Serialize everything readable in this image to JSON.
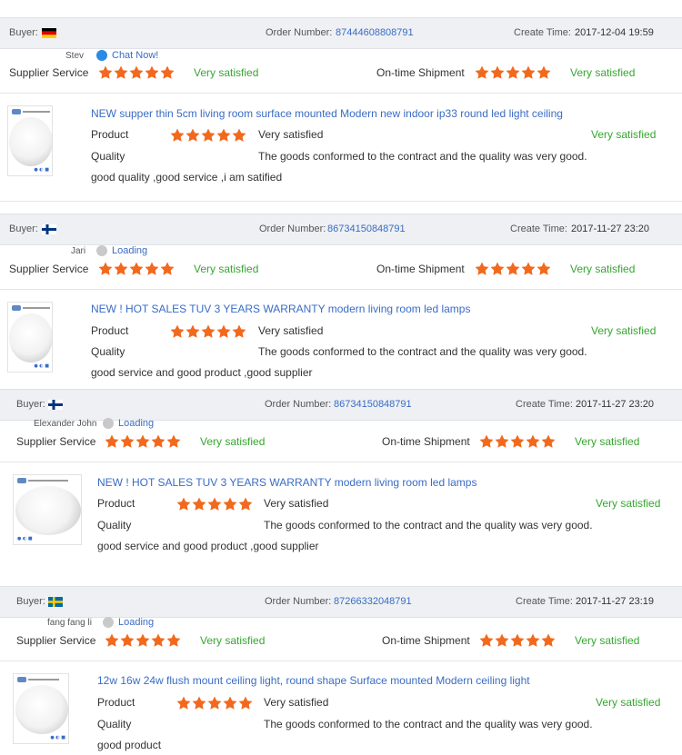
{
  "colors": {
    "link": "#3a6cc4",
    "positive": "#36a630",
    "star": "#f2691d",
    "header_bg": "#eef0f3"
  },
  "labels": {
    "buyer": "Buyer:",
    "order_number": "Order Number:",
    "create_time": "Create Time:",
    "supplier_service": "Supplier Service",
    "on_time_shipment": "On-time Shipment",
    "product": "Product",
    "quality": "Quality",
    "very_satisfied": "Very satisfied",
    "quality_text": "The goods conformed to the contract and the quality was very good."
  },
  "reviews": [
    {
      "buyer_country_flag": "germany",
      "order_number": "87444608808791",
      "create_time": "2017-12-04 19:59",
      "buyer_name": "Stev",
      "contact_link": "Chat Now!",
      "contact_icon": "chat-icon",
      "supplier_service_rating": 5,
      "on_time_shipment_rating": 5,
      "product_title": "NEW supper thin 5cm living room surface mounted Modern new indoor ip33 round led light ceiling",
      "product_rating": 5,
      "comment": "good quality ,good service ,i am satified"
    },
    {
      "buyer_country_flag": "finland",
      "order_number": "86734150848791",
      "create_time": "2017-11-27 23:20",
      "buyer_name": "Jari",
      "contact_link": "Loading",
      "contact_icon": "loading-icon",
      "supplier_service_rating": 5,
      "on_time_shipment_rating": 5,
      "product_title": "NEW ! HOT SALES TUV 3 YEARS WARRANTY modern living room led lamps",
      "product_rating": 5,
      "comment": "good service and good product ,good supplier"
    },
    {
      "buyer_country_flag": "finland",
      "order_number": "86734150848791",
      "create_time": "2017-11-27 23:20",
      "buyer_name": "Elexander John",
      "contact_link": "Loading",
      "contact_icon": "loading-icon",
      "supplier_service_rating": 5,
      "on_time_shipment_rating": 5,
      "product_title": "NEW ! HOT SALES TUV 3 YEARS WARRANTY modern living room led lamps",
      "product_rating": 5,
      "comment": "good service and good product ,good supplier"
    },
    {
      "buyer_country_flag": "sweden",
      "order_number": "87266332048791",
      "create_time": "2017-11-27 23:19",
      "buyer_name": "fang fang li",
      "contact_link": "Loading",
      "contact_icon": "loading-icon",
      "supplier_service_rating": 5,
      "on_time_shipment_rating": 5,
      "product_title": "12w 16w 24w flush mount ceiling light, round shape Surface mounted Modern ceiling light",
      "product_rating": 5,
      "comment": "good product"
    }
  ]
}
